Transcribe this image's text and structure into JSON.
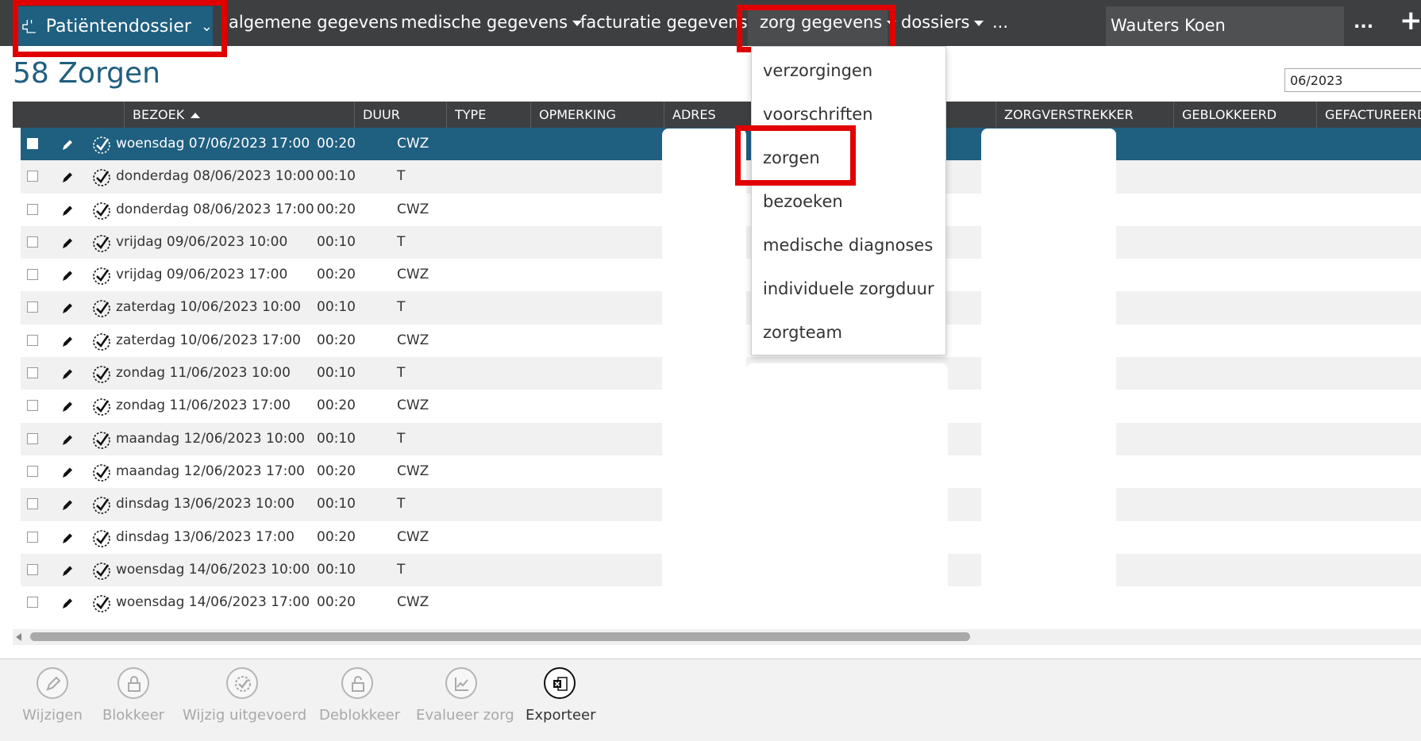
{
  "topbar": {
    "brand_label": "Patiëntendossier",
    "nav": [
      {
        "label": "algemene gegevens",
        "has_caret": false
      },
      {
        "label": "medische gegevens",
        "has_caret": true
      },
      {
        "label": "facturatie gegevens",
        "has_caret": false
      },
      {
        "label": "zorg gegevens",
        "has_caret": true
      },
      {
        "label": "dossiers",
        "has_caret": true
      },
      {
        "label": "...",
        "has_caret": false
      }
    ],
    "user_name": "Wauters Koen",
    "more_label": "...",
    "plus_label": "+"
  },
  "page": {
    "title": "58 Zorgen",
    "month_value": "06/2023"
  },
  "table": {
    "headers": [
      "BEZOEK",
      "DUUR",
      "TYPE",
      "OPMERKING",
      "ADRES",
      "ZORGVERSTREKKER",
      "GEBLOKKEERD",
      "GEFACTUREERD"
    ],
    "rows": [
      {
        "bezoek": "woensdag 07/06/2023 17:00",
        "duur": "00:20",
        "type": "CWZ",
        "selected": true
      },
      {
        "bezoek": "donderdag 08/06/2023 10:00",
        "duur": "00:10",
        "type": "T",
        "selected": false
      },
      {
        "bezoek": "donderdag 08/06/2023 17:00",
        "duur": "00:20",
        "type": "CWZ",
        "selected": false
      },
      {
        "bezoek": "vrijdag 09/06/2023 10:00",
        "duur": "00:10",
        "type": "T",
        "selected": false
      },
      {
        "bezoek": "vrijdag 09/06/2023 17:00",
        "duur": "00:20",
        "type": "CWZ",
        "selected": false
      },
      {
        "bezoek": "zaterdag 10/06/2023 10:00",
        "duur": "00:10",
        "type": "T",
        "selected": false
      },
      {
        "bezoek": "zaterdag 10/06/2023 17:00",
        "duur": "00:20",
        "type": "CWZ",
        "selected": false
      },
      {
        "bezoek": "zondag 11/06/2023 10:00",
        "duur": "00:10",
        "type": "T",
        "selected": false
      },
      {
        "bezoek": "zondag 11/06/2023 17:00",
        "duur": "00:20",
        "type": "CWZ",
        "selected": false
      },
      {
        "bezoek": "maandag 12/06/2023 10:00",
        "duur": "00:10",
        "type": "T",
        "selected": false
      },
      {
        "bezoek": "maandag 12/06/2023 17:00",
        "duur": "00:20",
        "type": "CWZ",
        "selected": false
      },
      {
        "bezoek": "dinsdag 13/06/2023 10:00",
        "duur": "00:10",
        "type": "T",
        "selected": false
      },
      {
        "bezoek": "dinsdag 13/06/2023 17:00",
        "duur": "00:20",
        "type": "CWZ",
        "selected": false
      },
      {
        "bezoek": "woensdag 14/06/2023 10:00",
        "duur": "00:10",
        "type": "T",
        "selected": false
      },
      {
        "bezoek": "woensdag 14/06/2023 17:00",
        "duur": "00:20",
        "type": "CWZ",
        "selected": false
      }
    ]
  },
  "dropdown": {
    "items": [
      "verzorgingen",
      "voorschriften",
      "zorgen",
      "bezoeken",
      "medische diagnoses",
      "individuele zorgduur",
      "zorgteam"
    ]
  },
  "toolbar": {
    "buttons": [
      {
        "label": "Wijzigen",
        "icon": "pencil-icon",
        "enabled": false
      },
      {
        "label": "Blokkeer",
        "icon": "lock-icon",
        "enabled": false
      },
      {
        "label": "Wijzig uitgevoerd",
        "icon": "check-badge-icon",
        "enabled": false
      },
      {
        "label": "Deblokkeer",
        "icon": "unlock-icon",
        "enabled": false
      },
      {
        "label": "Evalueer zorg",
        "icon": "chart-icon",
        "enabled": false
      },
      {
        "label": "Exporteer",
        "icon": "excel-icon",
        "enabled": true
      }
    ]
  },
  "colors": {
    "topbar": "#3d3f41",
    "accent": "#1f5f80",
    "highlight": "#e00000"
  }
}
